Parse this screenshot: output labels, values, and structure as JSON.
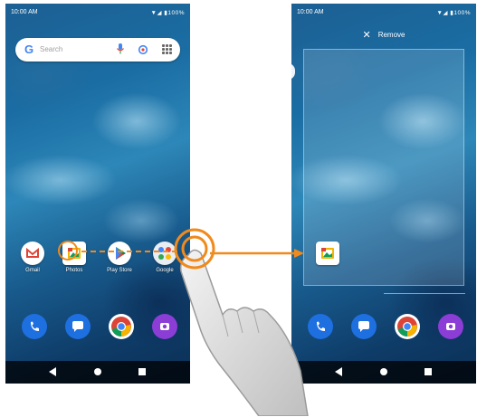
{
  "left_phone": {
    "status": {
      "time": "10:00 AM",
      "icons": "▼◢ ▮100%"
    },
    "search": {
      "logo": "G",
      "placeholder": "Search",
      "icons": [
        "mic-icon",
        "lens-icon",
        "apps-grid-icon"
      ]
    },
    "apps": [
      {
        "name": "Gmail",
        "icon": "gmail-icon"
      },
      {
        "name": "Photos",
        "icon": "photos-icon"
      },
      {
        "name": "Play Store",
        "icon": "play-store-icon"
      },
      {
        "name": "Google",
        "icon": "google-folder-icon"
      }
    ],
    "dock": [
      "phone-icon",
      "messages-icon",
      "chrome-icon",
      "camera-icon"
    ],
    "nav": [
      "back-icon",
      "home-icon",
      "recents-icon"
    ]
  },
  "right_phone": {
    "status": {
      "time": "10:00 AM",
      "icons": "▼◢ ▮100%"
    },
    "remove_label": "Remove",
    "remove_icon": "close-icon",
    "dragged_app_icon": "photos-icon",
    "dock": [
      "phone-icon",
      "messages-icon",
      "chrome-icon",
      "camera-icon"
    ],
    "nav": [
      "back-icon",
      "home-icon",
      "recents-icon"
    ]
  },
  "colors": {
    "accent": "#f08a1c",
    "phone_blue": "#1e6fe0",
    "camera_purple": "#8b3dd6"
  }
}
